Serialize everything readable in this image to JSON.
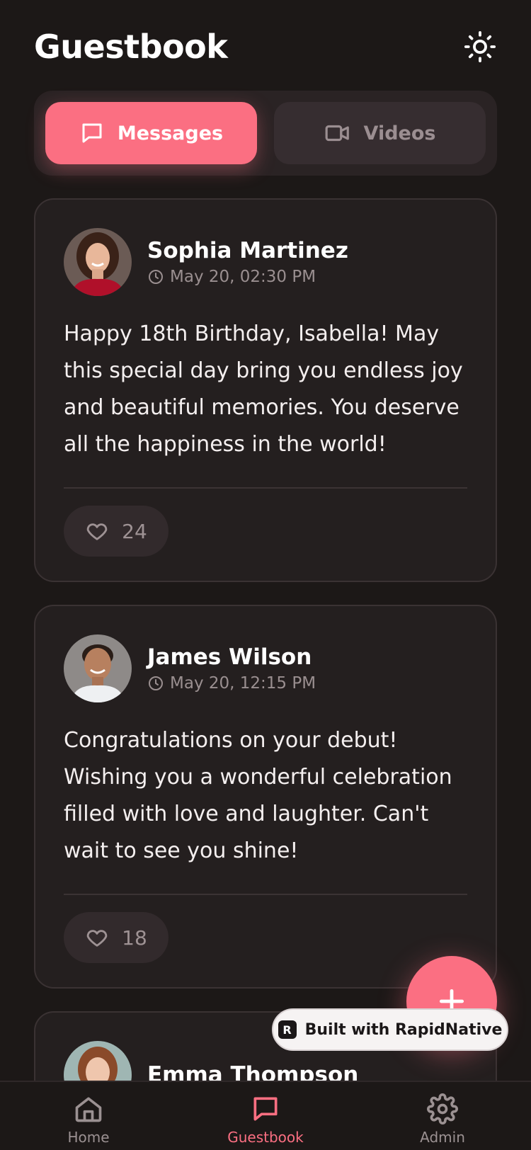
{
  "header": {
    "title": "Guestbook",
    "theme_icon": "sun-icon"
  },
  "tabs": [
    {
      "label": "Messages",
      "icon": "message-square-icon",
      "active": true
    },
    {
      "label": "Videos",
      "icon": "video-icon",
      "active": false
    }
  ],
  "messages": [
    {
      "author": "Sophia Martinez",
      "timestamp": "May 20, 02:30 PM",
      "text": "Happy 18th Birthday, Isabella! May this special day bring you endless joy and beautiful memories. You deserve all the happiness in the world!",
      "likes": "24"
    },
    {
      "author": "James Wilson",
      "timestamp": "May 20, 12:15 PM",
      "text": "Congratulations on your debut! Wishing you a wonderful celebration filled with love and laughter. Can't wait to see you shine!",
      "likes": "18"
    },
    {
      "author": "Emma Thompson"
    }
  ],
  "badge": {
    "label": "Built with RapidNative",
    "logo_text": "R"
  },
  "nav": [
    {
      "label": "Home",
      "icon": "home-icon",
      "active": false
    },
    {
      "label": "Guestbook",
      "icon": "message-square-icon",
      "active": true
    },
    {
      "label": "Admin",
      "icon": "gear-icon",
      "active": false
    }
  ],
  "colors": {
    "background": "#1c1817",
    "accent": "#fb6f82",
    "card": "#241f1f",
    "muted_text": "#9a8f90"
  }
}
